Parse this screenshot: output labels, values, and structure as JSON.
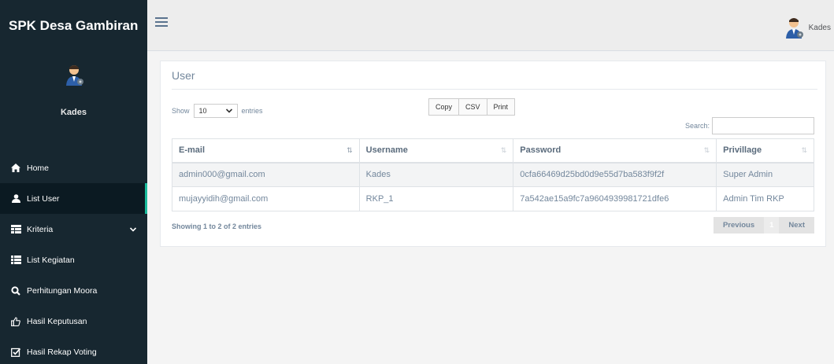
{
  "app": {
    "brand": "SPK Desa Gambiran"
  },
  "profile": {
    "name": "Kades"
  },
  "topbar": {
    "user_name": "Kades"
  },
  "nav": {
    "items": [
      {
        "label": "Home",
        "icon": "home-icon"
      },
      {
        "label": "List User",
        "icon": "user-icon"
      },
      {
        "label": "Kriteria",
        "icon": "table-icon"
      },
      {
        "label": "List Kegiatan",
        "icon": "list-icon"
      },
      {
        "label": "Perhitungan Moora",
        "icon": "search-icon"
      },
      {
        "label": "Hasil Keputusan",
        "icon": "thumbs-up-icon"
      },
      {
        "label": "Hasil Rekap Voting",
        "icon": "check-square-icon"
      }
    ]
  },
  "panel": {
    "title": "User"
  },
  "datatable": {
    "length_prefix": "Show",
    "length_value": "10",
    "length_suffix": "entries",
    "buttons": [
      "Copy",
      "CSV",
      "Print"
    ],
    "search_label": "Search:",
    "columns": [
      "E-mail",
      "Username",
      "Password",
      "Privillage"
    ],
    "rows": [
      [
        "admin000@gmail.com",
        "Kades",
        "0cfa66469d25bd0d9e55d7ba583f9f2f",
        "Super Admin"
      ],
      [
        "mujayyidih@gmail.com",
        "RKP_1",
        "7a542ae15a9fc7a9604939981721dfe6",
        "Admin Tim RKP"
      ]
    ],
    "info": "Showing 1 to 2 of 2 entries",
    "pager": {
      "previous": "Previous",
      "current": "1",
      "next": "Next"
    }
  },
  "colors": {
    "sidebar": "#172730",
    "accent": "#1abb9c",
    "text_muted": "#73879c"
  }
}
